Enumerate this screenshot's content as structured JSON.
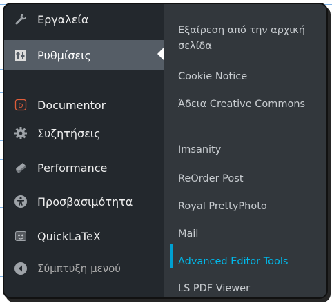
{
  "menu": {
    "items": [
      {
        "label": "Εργαλεία",
        "icon": "wrench-icon"
      },
      {
        "label": "Ρυθμίσεις",
        "icon": "settings-sliders-icon",
        "active": true
      },
      {
        "label": "Documentor",
        "icon": "documentor-icon"
      },
      {
        "label": "Συζητήσεις",
        "icon": "gear-icon"
      },
      {
        "label": "Performance",
        "icon": "performance-icon"
      },
      {
        "label": "Προσβασιμότητα",
        "icon": "accessibility-icon"
      },
      {
        "label": "QuickLaTeX",
        "icon": "quicklatex-icon"
      }
    ],
    "collapse_label": "Σύμπτυξη μενού",
    "collapse_icon": "collapse-arrow-icon"
  },
  "submenu": {
    "items": [
      {
        "label": "Εξαίρεση από την αρχική σελίδα"
      },
      {
        "label": "Cookie Notice"
      },
      {
        "label": "Άδεια Creative Commons"
      },
      {
        "label": "Imsanity"
      },
      {
        "label": "ReOrder Post"
      },
      {
        "label": "Royal PrettyPhoto"
      },
      {
        "label": "Mail"
      },
      {
        "label": "Advanced Editor Tools",
        "current": true
      },
      {
        "label": "LS PDF Viewer"
      }
    ]
  },
  "colors": {
    "sidebar_bg": "#23282d",
    "active_bg": "#555d66",
    "submenu_bg": "#32373c",
    "current_link": "#00b9eb",
    "accent_bar": "#00a0d2"
  }
}
